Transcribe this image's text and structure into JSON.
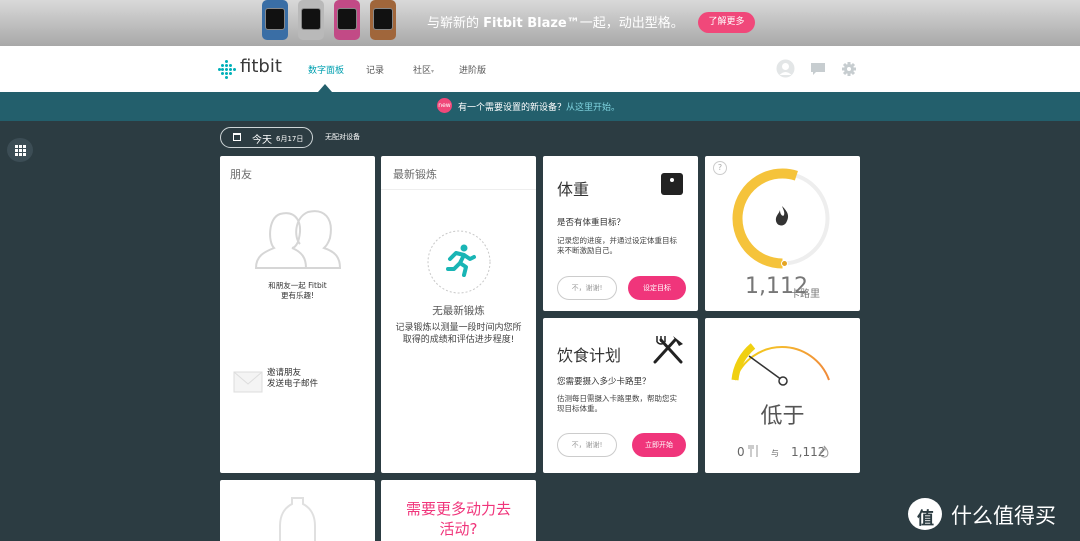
{
  "banner": {
    "text_prefix": "与崭新的",
    "text_brand": "Fitbit Blaze™",
    "text_suffix": "一起，动出型格。",
    "button_label": "了解更多",
    "watch_colors": [
      "#3a6ea5",
      "#b9b9b9",
      "#c24a86",
      "#a0663b"
    ]
  },
  "nav": {
    "logo": "fitbit",
    "items": [
      "数字面板",
      "记录",
      "社区",
      "进阶版"
    ],
    "community_caret": "▾"
  },
  "notice": {
    "icon": "new",
    "text": "有一个需要设置的新设备？",
    "link": "从这里开始。"
  },
  "date": {
    "today": "今天",
    "date": "6月17日",
    "no_device": "无配对设备"
  },
  "tiles": {
    "friends": {
      "title": "朋友",
      "message_line1": "和朋友一起 Fitbit",
      "message_line2": "更有乐趣!",
      "invite_line1": "邀请朋友",
      "invite_line2": "发送电子邮件"
    },
    "exercise": {
      "title": "最新锻炼",
      "empty": "无最新锻炼",
      "desc_line1": "记录锻炼以测量一段时间内您所",
      "desc_line2": "取得的成绩和评估进步程度!"
    },
    "weight": {
      "title": "体重",
      "question": "是否有体重目标？",
      "desc_line1": "记录您的进度，并通过设定体重目标",
      "desc_line2": "来不断激励自己。",
      "no_button": "不，谢谢!",
      "yes_button": "设定目标"
    },
    "calories": {
      "help": "?",
      "value": "1,112",
      "unit": "卡路里",
      "progress": 0.55
    },
    "food": {
      "title": "饮食计划",
      "question": "您需要摄入多少卡路里？",
      "desc_line1": "估测每日需摄入卡路里数，帮助您实",
      "desc_line2": "现目标体重。",
      "no_button": "不，谢谢!",
      "yes_button": "立即开始"
    },
    "balance": {
      "status": "低于",
      "food_value": "0",
      "and_label": "与",
      "burn_value": "1,112"
    },
    "water": {},
    "motivation": {
      "line1": "需要更多动力去",
      "line2": "活动?"
    }
  },
  "watermark": "什么值得买",
  "colors": {
    "accent_teal": "#00a0b0",
    "accent_pink": "#f0357b",
    "gauge_yellow": "#f5c33b",
    "page_bg": "#2c3c42",
    "notice_bg": "#235f6c"
  }
}
